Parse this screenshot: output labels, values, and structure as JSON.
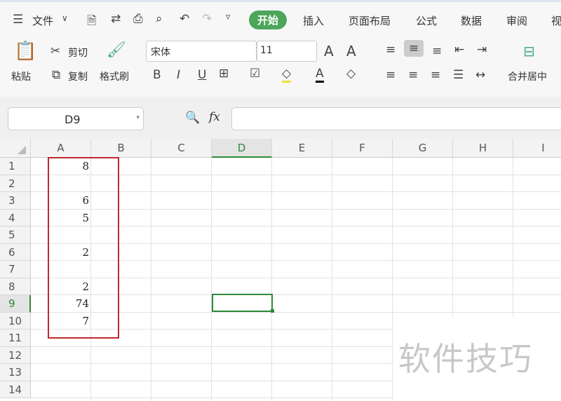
{
  "menu": {
    "file": "文件",
    "tabs": [
      "开始",
      "插入",
      "页面布局",
      "公式",
      "数据",
      "审阅",
      "视"
    ],
    "active_tab": "开始"
  },
  "quick_icons": [
    "save-icon",
    "share-icon",
    "print-icon",
    "preview-icon",
    "undo-icon",
    "redo-icon",
    "more-icon"
  ],
  "ribbon": {
    "paste": "粘贴",
    "cut": "剪切",
    "copy": "复制",
    "format_painter": "格式刷",
    "font_name": "宋体",
    "font_size": "11",
    "bold": "B",
    "italic": "I",
    "underline": "U",
    "font_color": "A",
    "merge": "合并居中",
    "grow": "A",
    "shrink": "A"
  },
  "formula": {
    "name_box": "D9",
    "fx": "fx",
    "value": ""
  },
  "columns": [
    "A",
    "B",
    "C",
    "D",
    "E",
    "F",
    "G",
    "H",
    "I"
  ],
  "rows": [
    "1",
    "2",
    "3",
    "4",
    "5",
    "6",
    "7",
    "8",
    "9",
    "10",
    "11",
    "12",
    "13",
    "14"
  ],
  "cells_A": [
    "8",
    "",
    "6",
    "5",
    "",
    "2",
    "",
    "2",
    "74",
    "7",
    "",
    "",
    "",
    ""
  ],
  "selected_cell": "D9",
  "watermark": "软件技巧",
  "colors": {
    "accent": "#4ca65a",
    "highlight_box": "#c0282d",
    "selection": "#2f8a3a"
  }
}
